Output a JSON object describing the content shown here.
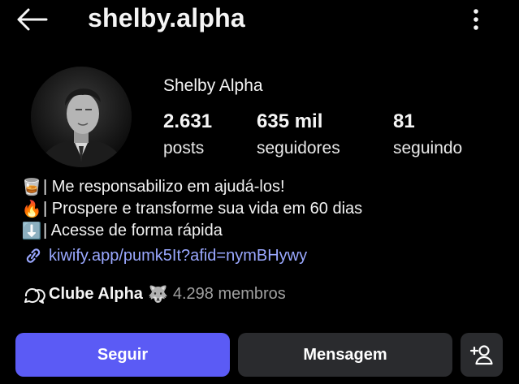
{
  "header": {
    "username": "shelby.alpha",
    "back_icon": "arrow-left-icon",
    "more_icon": "vertical-dots-icon"
  },
  "profile": {
    "display_name": "Shelby Alpha",
    "avatar_icon": "profile-photo"
  },
  "stats": [
    {
      "value": "2.631",
      "label": "posts"
    },
    {
      "value": "635 mil",
      "label": "seguidores"
    },
    {
      "value": "81",
      "label": "seguindo"
    }
  ],
  "bio": {
    "lines": [
      {
        "emoji": "🥃",
        "text": "| Me responsabilizo em ajudá-los!"
      },
      {
        "emoji": "🔥",
        "text": "| Prospere e transforme sua vida em 60 dias"
      },
      {
        "emoji": "⬇️",
        "text": "| Acesse de forma rápida"
      }
    ],
    "link": "kiwify.app/pumk5It?afid=nymBHywy",
    "link_icon": "link-icon"
  },
  "community": {
    "name": "Clube Alpha",
    "emoji": "🐺",
    "members": "4.298 membros",
    "icon": "community-chat-icon"
  },
  "actions": {
    "follow": "Seguir",
    "message": "Mensagem",
    "add_user_icon": "add-person-icon"
  },
  "colors": {
    "background": "#000000",
    "primary": "#5b5bf5",
    "secondary_button": "#2a2b2e",
    "link": "#9aa8ff"
  }
}
